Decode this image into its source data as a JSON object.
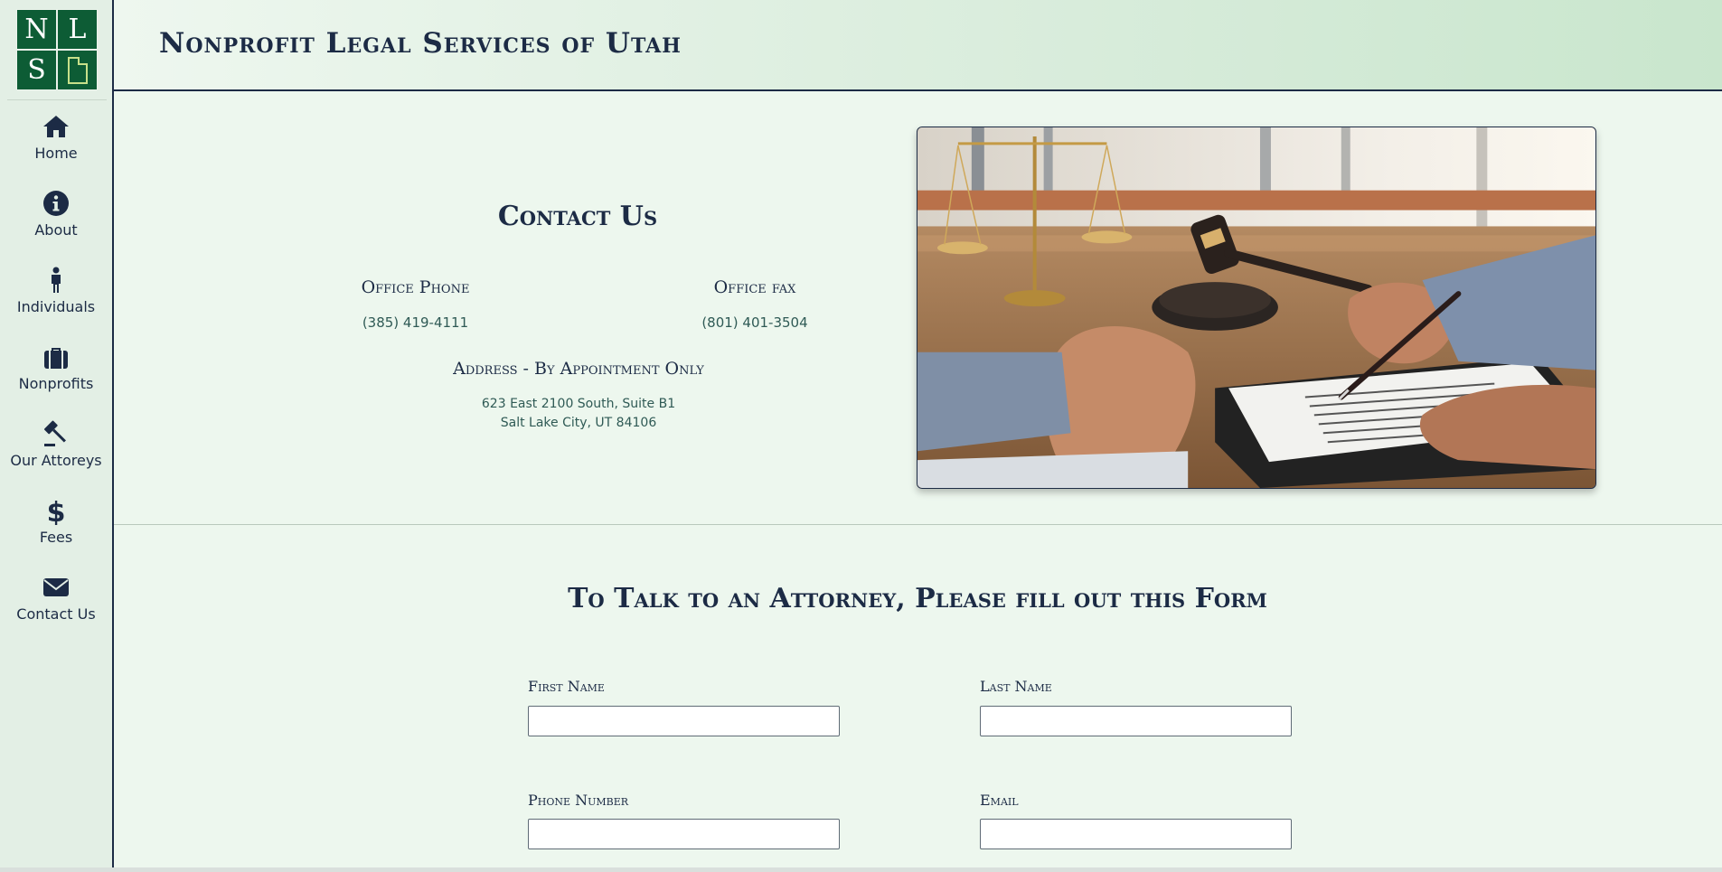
{
  "logo": {
    "letters": [
      "N",
      "L",
      "S"
    ]
  },
  "header": {
    "title": "Nonprofit Legal Services of Utah"
  },
  "nav": [
    {
      "label": "Home",
      "icon": "home-icon"
    },
    {
      "label": "About",
      "icon": "info-icon"
    },
    {
      "label": "Individuals",
      "icon": "person-icon"
    },
    {
      "label": "Nonprofits",
      "icon": "briefcase-icon"
    },
    {
      "label": "Our Attoreys",
      "icon": "gavel-icon"
    },
    {
      "label": "Fees",
      "icon": "dollar-icon"
    },
    {
      "label": "Contact Us",
      "icon": "envelope-icon"
    }
  ],
  "contact": {
    "title": "Contact Us",
    "phone_label": "Office Phone",
    "phone": "(385) 419-4111",
    "fax_label": "Office fax",
    "fax": "(801) 401-3504",
    "address_label": "Address - By Appointment Only",
    "address_line1": "623 East 2100 South, Suite B1",
    "address_line2": "Salt Lake City, UT 84106"
  },
  "form": {
    "title": "To Talk to an Attorney, Please fill out this Form",
    "first_name_label": "First Name",
    "first_name_value": "",
    "last_name_label": "Last Name",
    "last_name_value": "",
    "phone_label": "Phone Number",
    "phone_value": "",
    "email_label": "Email",
    "email_value": ""
  },
  "colors": {
    "navy": "#1c2b45",
    "logo_green": "#0d5c35",
    "page_bg": "#edf7ee",
    "link_teal": "#2f5a55"
  }
}
